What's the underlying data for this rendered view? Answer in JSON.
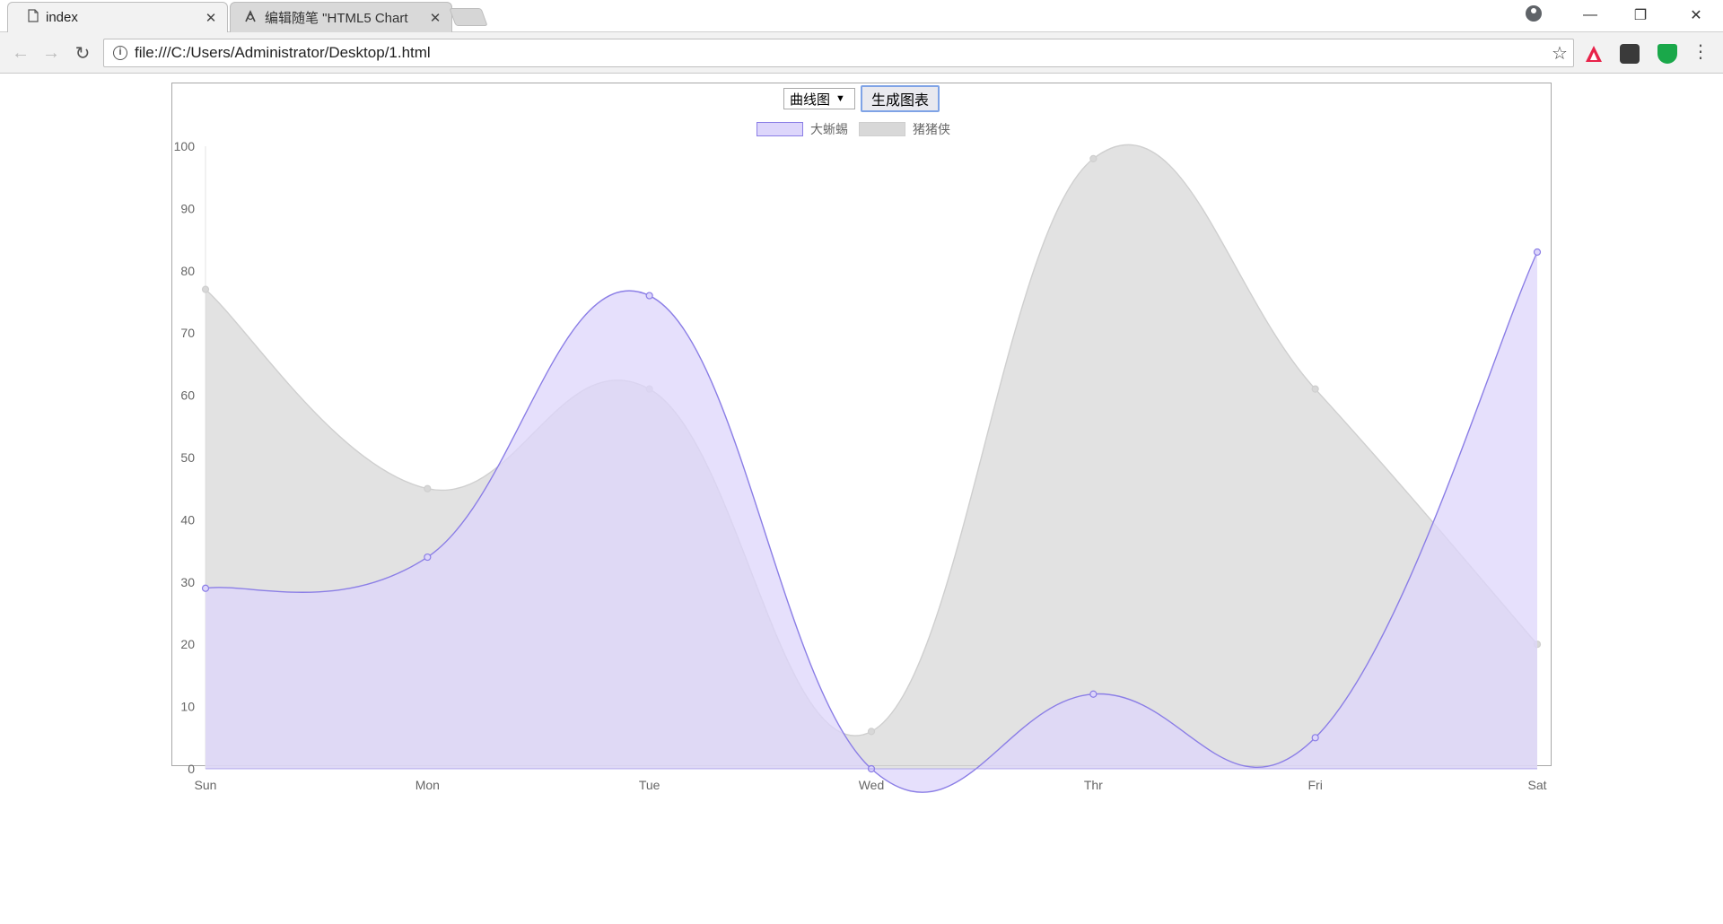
{
  "browser": {
    "tabs": [
      {
        "title": "index",
        "active": true
      },
      {
        "title": "编辑随笔 \"HTML5 Chart",
        "active": false
      }
    ],
    "url": "file:///C:/Users/Administrator/Desktop/1.html"
  },
  "page": {
    "chart_type_select": "曲线图",
    "generate_button": "生成图表"
  },
  "chart_data": {
    "type": "area",
    "categories": [
      "Sun",
      "Mon",
      "Tue",
      "Wed",
      "Thr",
      "Fri",
      "Sat"
    ],
    "ylim": [
      0,
      100
    ],
    "yticks": [
      0,
      10,
      20,
      30,
      40,
      50,
      60,
      70,
      80,
      90,
      100
    ],
    "legend_position": "top-center",
    "series": [
      {
        "name": "大蜥蜴",
        "values": [
          29,
          34,
          76,
          0,
          12,
          5,
          83
        ],
        "fill": "#ddd6fb",
        "stroke": "#8b7ee6"
      },
      {
        "name": "猪猪侠",
        "values": [
          77,
          45,
          61,
          6,
          98,
          61,
          20
        ],
        "fill": "#d8d8d8",
        "stroke": "#cfcfcf"
      }
    ]
  }
}
